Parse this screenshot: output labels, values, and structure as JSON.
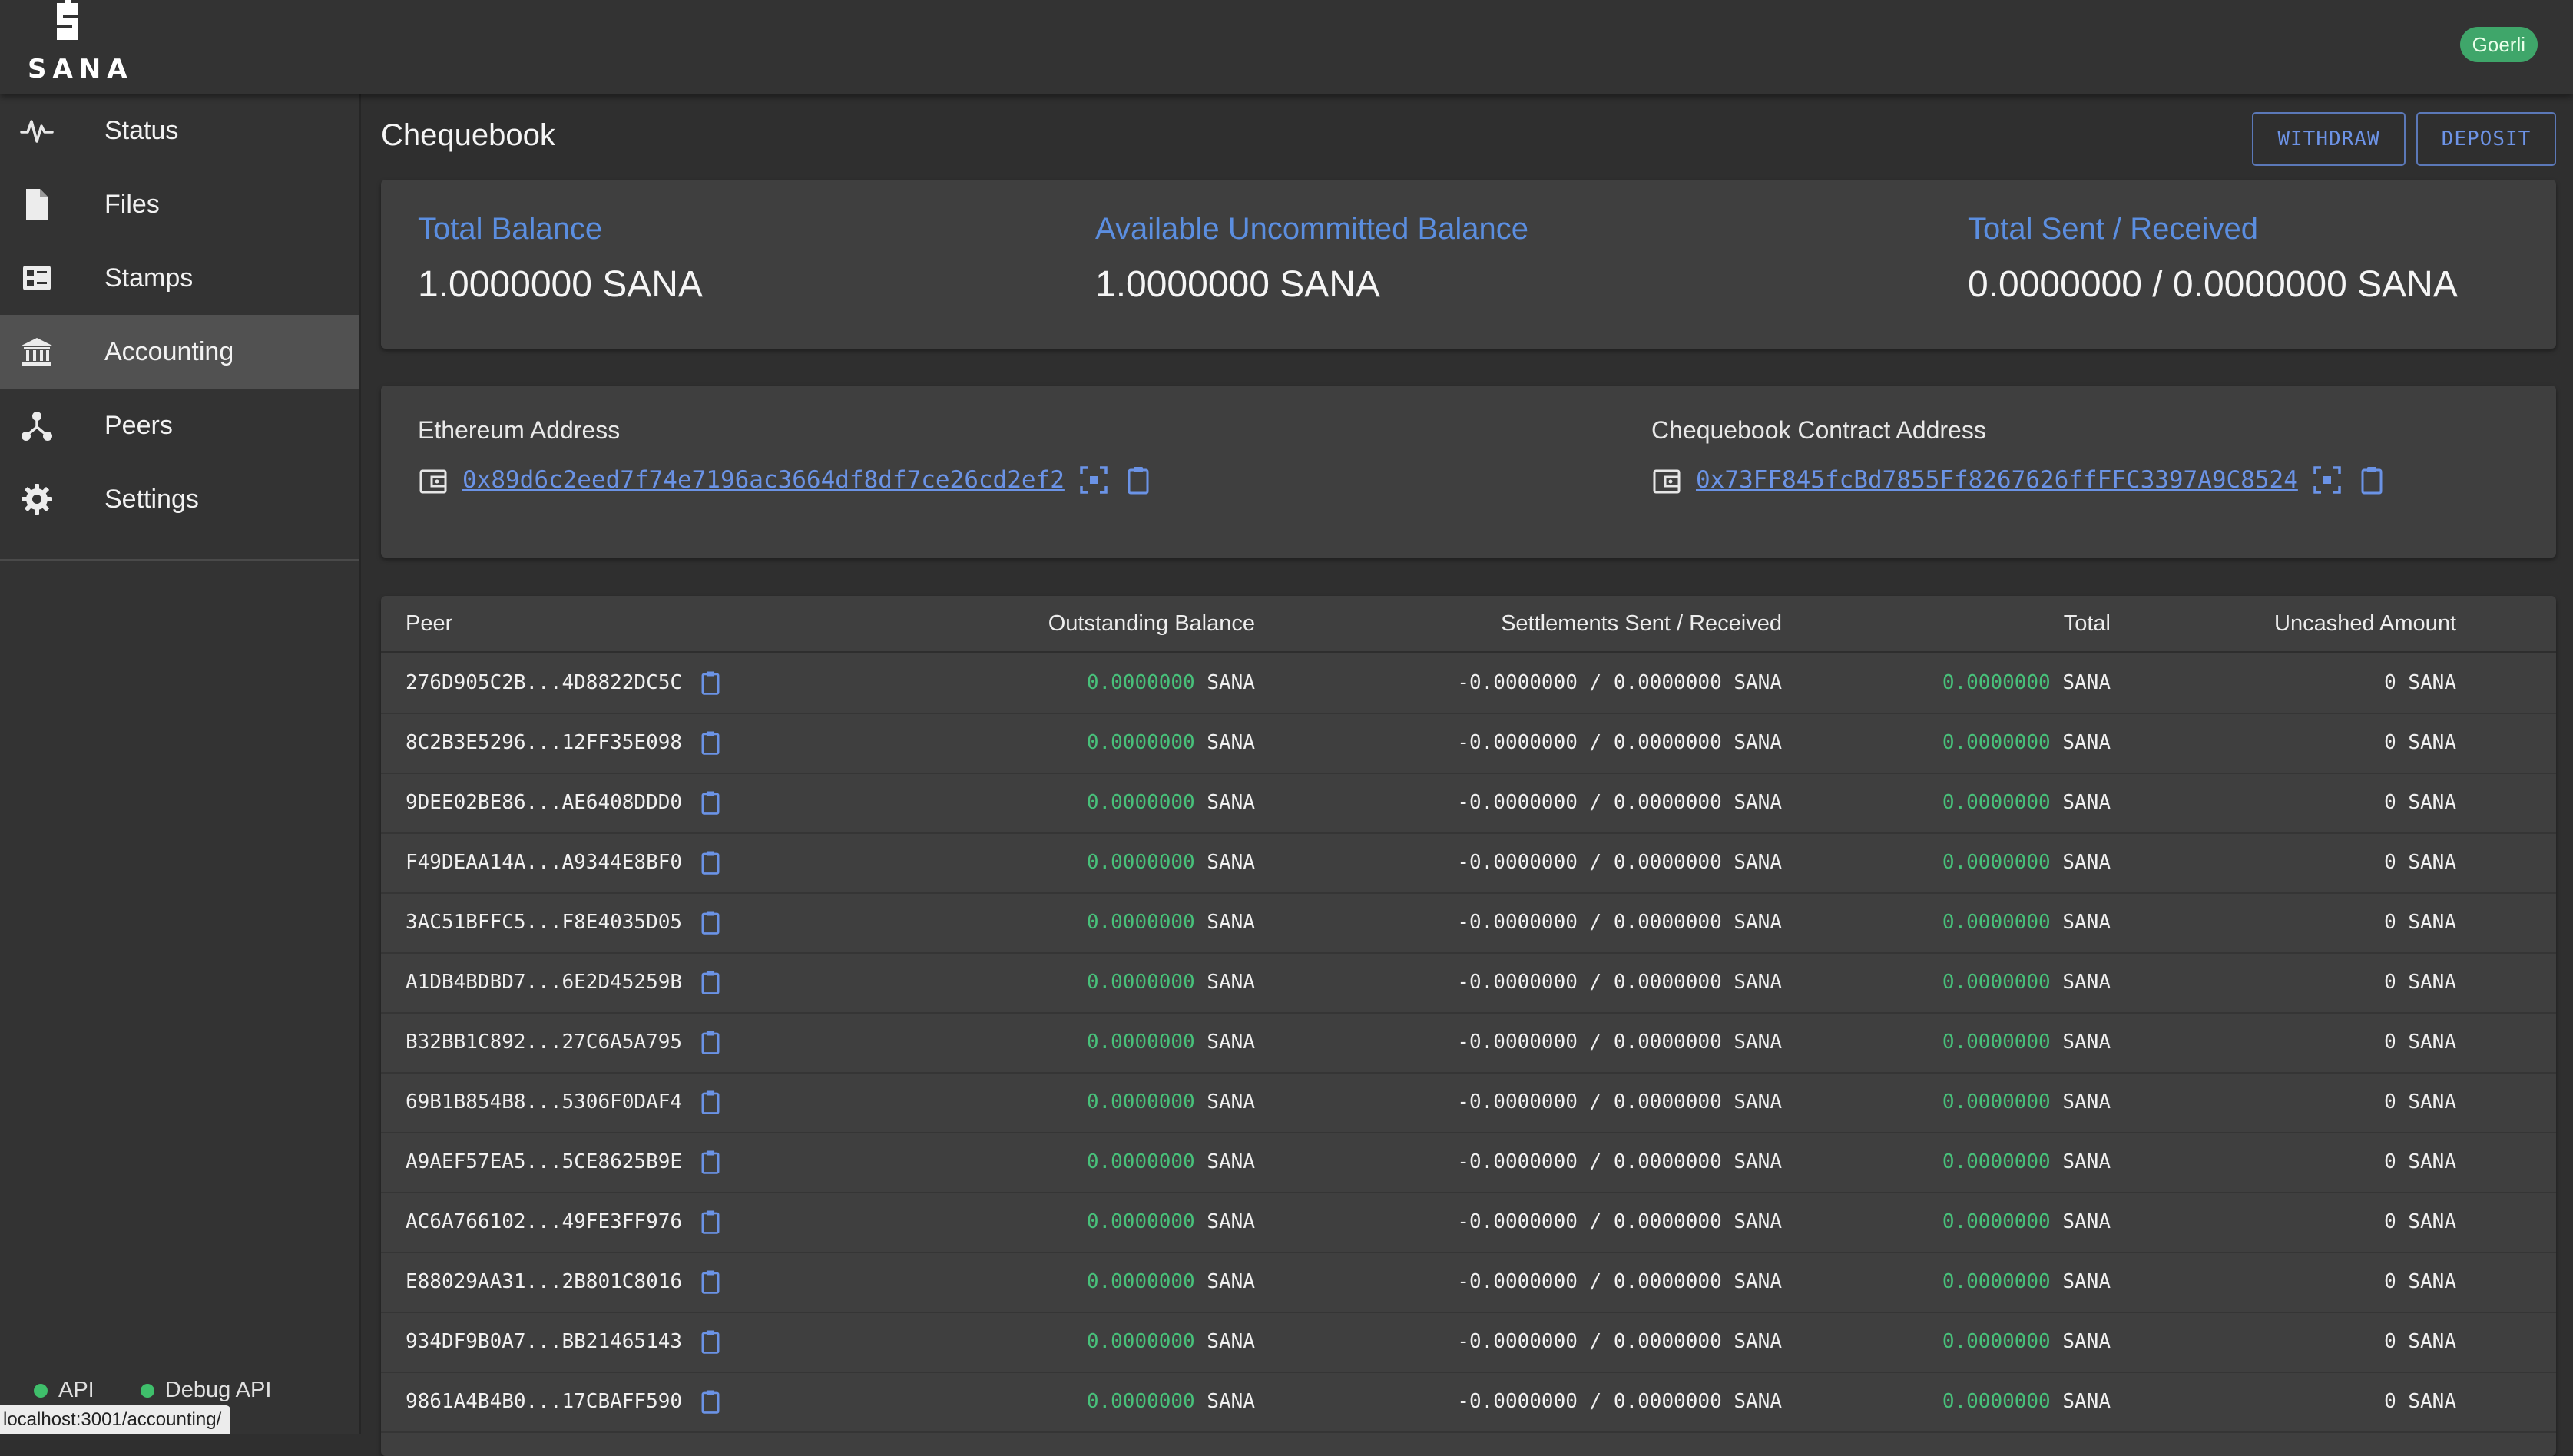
{
  "app": {
    "logo_text": "SANA",
    "network_badge": "Goerli"
  },
  "sidebar": {
    "items": [
      {
        "label": "Status",
        "icon": "activity-icon",
        "active": false
      },
      {
        "label": "Files",
        "icon": "file-icon",
        "active": false
      },
      {
        "label": "Stamps",
        "icon": "stamp-icon",
        "active": false
      },
      {
        "label": "Accounting",
        "icon": "bank-icon",
        "active": true
      },
      {
        "label": "Peers",
        "icon": "peers-icon",
        "active": false
      },
      {
        "label": "Settings",
        "icon": "gear-icon",
        "active": false
      }
    ],
    "status": {
      "api_label": "API",
      "debug_api_label": "Debug API",
      "status_color": "#3fbf6b"
    }
  },
  "statusbar": {
    "url": "localhost:3001/accounting/"
  },
  "main": {
    "title": "Chequebook",
    "withdraw_label": "WITHDRAW",
    "deposit_label": "DEPOSIT",
    "balances": {
      "total_label": "Total Balance",
      "total_value": "1.0000000 SANA",
      "available_label": "Available Uncommitted Balance",
      "available_value": "1.0000000 SANA",
      "sent_received_label": "Total Sent / Received",
      "sent_received_value": "0.0000000 / 0.0000000 SANA"
    },
    "addresses": {
      "ethereum_label": "Ethereum Address",
      "ethereum_value": "0x89d6c2eed7f74e7196ac3664df8df7ce26cd2ef2",
      "contract_label": "Chequebook Contract Address",
      "contract_value": "0x73FF845fcBd7855Ff8267626ffFFC3397A9C8524"
    },
    "table": {
      "columns": {
        "peer": "Peer",
        "outstanding": "Outstanding Balance",
        "settlements": "Settlements Sent / Received",
        "total": "Total",
        "uncashed": "Uncashed Amount"
      },
      "rows": [
        {
          "peer": "276D905C2B...4D8822DC5C",
          "outstanding": "0.0000000",
          "settlements": "-0.0000000 / 0.0000000",
          "total": "0.0000000",
          "uncashed": "0"
        },
        {
          "peer": "8C2B3E5296...12FF35E098",
          "outstanding": "0.0000000",
          "settlements": "-0.0000000 / 0.0000000",
          "total": "0.0000000",
          "uncashed": "0"
        },
        {
          "peer": "9DEE02BE86...AE6408DDD0",
          "outstanding": "0.0000000",
          "settlements": "-0.0000000 / 0.0000000",
          "total": "0.0000000",
          "uncashed": "0"
        },
        {
          "peer": "F49DEAA14A...A9344E8BF0",
          "outstanding": "0.0000000",
          "settlements": "-0.0000000 / 0.0000000",
          "total": "0.0000000",
          "uncashed": "0"
        },
        {
          "peer": "3AC51BFFC5...F8E4035D05",
          "outstanding": "0.0000000",
          "settlements": "-0.0000000 / 0.0000000",
          "total": "0.0000000",
          "uncashed": "0"
        },
        {
          "peer": "A1DB4BDBD7...6E2D45259B",
          "outstanding": "0.0000000",
          "settlements": "-0.0000000 / 0.0000000",
          "total": "0.0000000",
          "uncashed": "0"
        },
        {
          "peer": "B32BB1C892...27C6A5A795",
          "outstanding": "0.0000000",
          "settlements": "-0.0000000 / 0.0000000",
          "total": "0.0000000",
          "uncashed": "0"
        },
        {
          "peer": "69B1B854B8...5306F0DAF4",
          "outstanding": "0.0000000",
          "settlements": "-0.0000000 / 0.0000000",
          "total": "0.0000000",
          "uncashed": "0"
        },
        {
          "peer": "A9AEF57EA5...5CE8625B9E",
          "outstanding": "0.0000000",
          "settlements": "-0.0000000 / 0.0000000",
          "total": "0.0000000",
          "uncashed": "0"
        },
        {
          "peer": "AC6A766102...49FE3FF976",
          "outstanding": "0.0000000",
          "settlements": "-0.0000000 / 0.0000000",
          "total": "0.0000000",
          "uncashed": "0"
        },
        {
          "peer": "E88029AA31...2B801C8016",
          "outstanding": "0.0000000",
          "settlements": "-0.0000000 / 0.0000000",
          "total": "0.0000000",
          "uncashed": "0"
        },
        {
          "peer": "934DF9B0A7...BB21465143",
          "outstanding": "0.0000000",
          "settlements": "-0.0000000 / 0.0000000",
          "total": "0.0000000",
          "uncashed": "0"
        },
        {
          "peer": "9861A4B4B0...17CBAFF590",
          "outstanding": "0.0000000",
          "settlements": "-0.0000000 / 0.0000000",
          "total": "0.0000000",
          "uncashed": "0"
        }
      ],
      "unit": "SANA"
    }
  },
  "colors": {
    "accent": "#5b8ee0",
    "positive": "#48c07a",
    "badge": "#3fa66a"
  }
}
